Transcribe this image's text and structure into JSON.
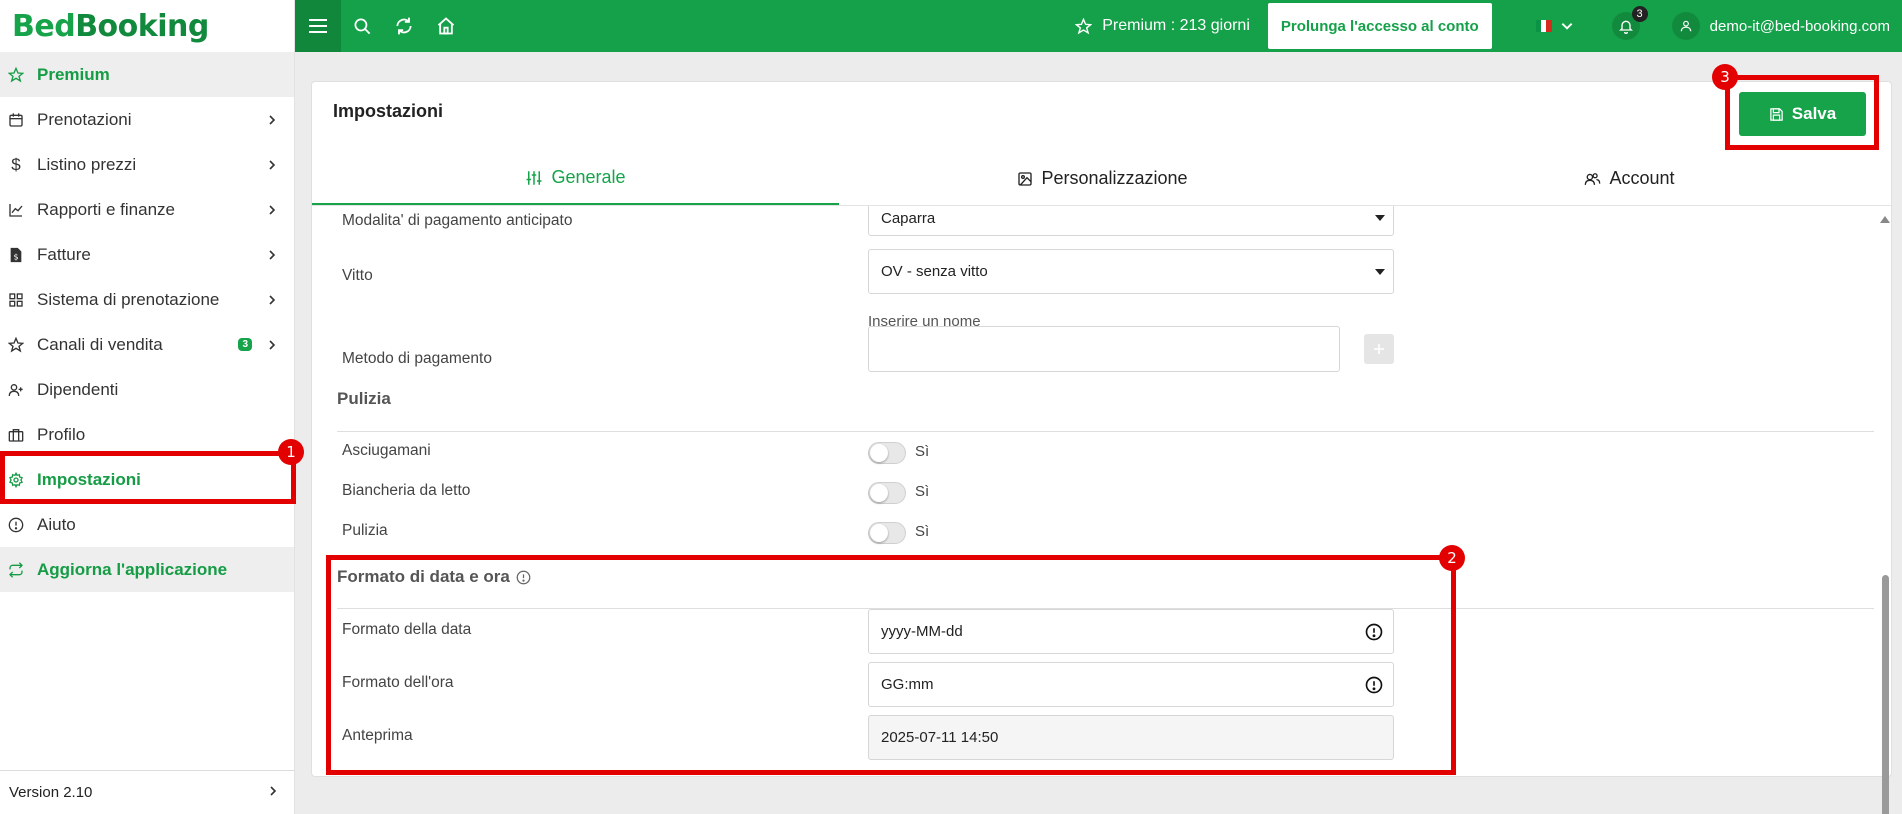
{
  "app": {
    "logo_part1": "Bed",
    "logo_part2": "Booking"
  },
  "topbar": {
    "premium_text": "Premium : 213 giorni",
    "extend_button": "Prolunga l'accesso al conto",
    "notification_count": "3",
    "user_email": "demo-it@bed-booking.com",
    "language": "IT"
  },
  "sidebar": {
    "items": [
      {
        "label": "Premium",
        "icon": "star-icon"
      },
      {
        "label": "Prenotazioni",
        "icon": "calendar-icon"
      },
      {
        "label": "Listino prezzi",
        "icon": "dollar-icon"
      },
      {
        "label": "Rapporti e finanze",
        "icon": "chart-icon"
      },
      {
        "label": "Fatture",
        "icon": "invoice-icon"
      },
      {
        "label": "Sistema di prenotazione",
        "icon": "grid-icon"
      },
      {
        "label": "Canali di vendita",
        "icon": "star-icon",
        "badge": "3"
      },
      {
        "label": "Dipendenti",
        "icon": "user-plus-icon"
      },
      {
        "label": "Profilo",
        "icon": "building-icon"
      },
      {
        "label": "Impostazioni",
        "icon": "gear-icon"
      },
      {
        "label": "Aiuto",
        "icon": "info-icon"
      },
      {
        "label": "Aggiorna l'applicazione",
        "icon": "refresh-icon"
      }
    ],
    "version": "Version 2.10"
  },
  "settings": {
    "title": "Impostazioni",
    "save_label": "Salva",
    "tabs": [
      {
        "label": "Generale",
        "active": true
      },
      {
        "label": "Personalizzazione",
        "active": false
      },
      {
        "label": "Account",
        "active": false
      }
    ],
    "payment": {
      "advance_label": "Modalita' di pagamento anticipato",
      "advance_value": "Caparra",
      "board_label": "Vitto",
      "board_value": "OV - senza vitto",
      "name_hint": "Inserire un nome",
      "method_label": "Metodo di pagamento",
      "method_value": ""
    },
    "cleaning": {
      "section_title": "Pulizia",
      "toggles": [
        {
          "label": "Asciugamani",
          "state_label": "Sì",
          "on": false
        },
        {
          "label": "Biancheria da letto",
          "state_label": "Sì",
          "on": false
        },
        {
          "label": "Pulizia",
          "state_label": "Sì",
          "on": false
        }
      ]
    },
    "datetime": {
      "section_title": "Formato di data e ora",
      "date_label": "Formato della data",
      "date_value": "yyyy-MM-dd",
      "time_label": "Formato dell'ora",
      "time_value": "GG:mm",
      "preview_label": "Anteprima",
      "preview_value": "2025-07-11 14:50"
    }
  },
  "annotations": [
    "1",
    "2",
    "3"
  ],
  "colors": {
    "brand_green": "#15a149",
    "annotation_red": "#e30000"
  }
}
